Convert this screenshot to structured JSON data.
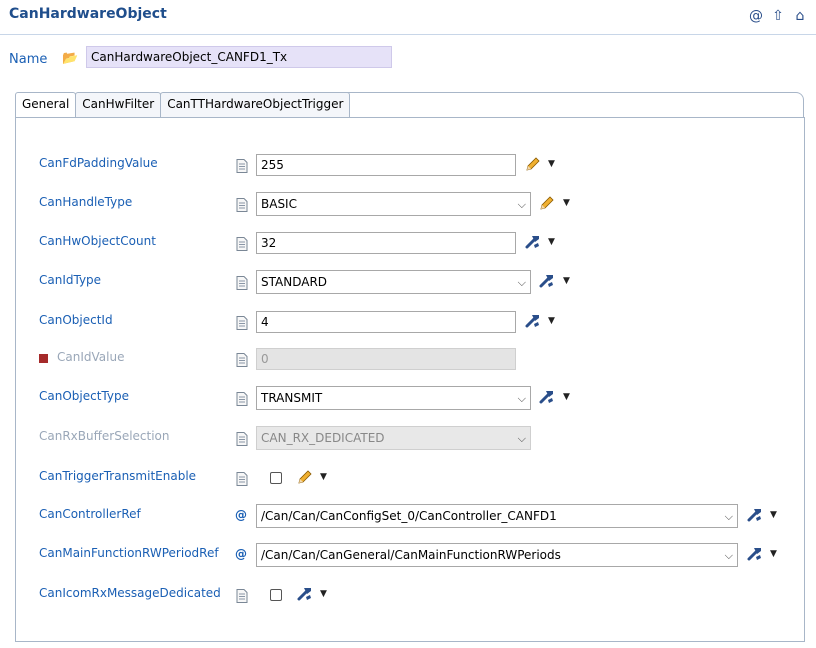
{
  "header": {
    "title": "CanHardwareObject",
    "icons": [
      "at-icon",
      "up-arrow-icon",
      "home-icon"
    ]
  },
  "name": {
    "label": "Name",
    "value": "CanHardwareObject_CANFD1_Tx"
  },
  "tabs": [
    {
      "label": "General",
      "active": true
    },
    {
      "label": "CanHwFilter",
      "active": false
    },
    {
      "label": "CanTTHardwareObjectTrigger",
      "active": false
    }
  ],
  "fields": {
    "fd_padding": {
      "label": "CanFdPaddingValue",
      "value": "255"
    },
    "handle_type": {
      "label": "CanHandleType",
      "value": "BASIC"
    },
    "hw_object_count": {
      "label": "CanHwObjectCount",
      "value": "32"
    },
    "id_type": {
      "label": "CanIdType",
      "value": "STANDARD"
    },
    "object_id": {
      "label": "CanObjectId",
      "value": "4"
    },
    "id_value": {
      "label": "CanIdValue",
      "value": "0"
    },
    "object_type": {
      "label": "CanObjectType",
      "value": "TRANSMIT"
    },
    "rx_buffer": {
      "label": "CanRxBufferSelection",
      "value": "CAN_RX_DEDICATED"
    },
    "trigger_transmit": {
      "label": "CanTriggerTransmitEnable",
      "checked": false
    },
    "controller_ref": {
      "label": "CanControllerRef",
      "value": "/Can/Can/CanConfigSet_0/CanController_CANFD1"
    },
    "main_function_ref": {
      "label": "CanMainFunctionRWPeriodRef",
      "value": "/Can/Can/CanGeneral/CanMainFunctionRWPeriods"
    },
    "icom_rx": {
      "label": "CanIcomRxMessageDedicated",
      "checked": false
    }
  },
  "colors": {
    "label_blue": "#1a5fb4",
    "title_blue": "#1f4e8c",
    "error_marker": "#a52a2a",
    "name_field_bg": "#e6e2f8"
  }
}
